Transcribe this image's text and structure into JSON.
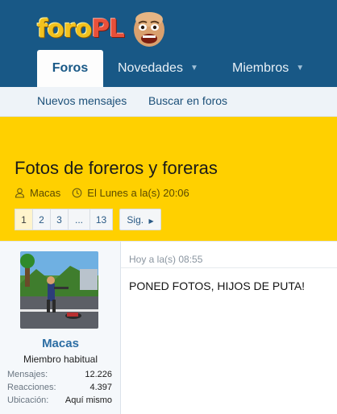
{
  "logo": {
    "part1": "foro",
    "part2": "PL"
  },
  "nav": {
    "tabs": [
      {
        "label": "Foros"
      },
      {
        "label": "Novedades"
      },
      {
        "label": "Miembros"
      }
    ],
    "subnav": [
      "Nuevos mensajes",
      "Buscar en foros"
    ]
  },
  "thread": {
    "title": "Fotos de foreros y foreras",
    "author": "Macas",
    "date": "El Lunes a la(s) 20:06",
    "pages": [
      "1",
      "2",
      "3",
      "...",
      "13"
    ],
    "next_label": "Sig."
  },
  "post": {
    "username": "Macas",
    "user_title": "Miembro habitual",
    "stats": [
      {
        "label": "Mensajes:",
        "value": "12.226"
      },
      {
        "label": "Reacciones:",
        "value": "4.397"
      },
      {
        "label": "Ubicación:",
        "value": "Aquí mismo"
      }
    ],
    "date": "Hoy a la(s) 08:55",
    "body": "PONED FOTOS, HIJOS DE PUTA!"
  },
  "colors": {
    "header": "#185886",
    "thread_band": "#ffd000",
    "link": "#2c6da3"
  },
  "icons": [
    "user-icon",
    "clock-icon",
    "chevron-down-icon",
    "chevron-right-icon"
  ]
}
